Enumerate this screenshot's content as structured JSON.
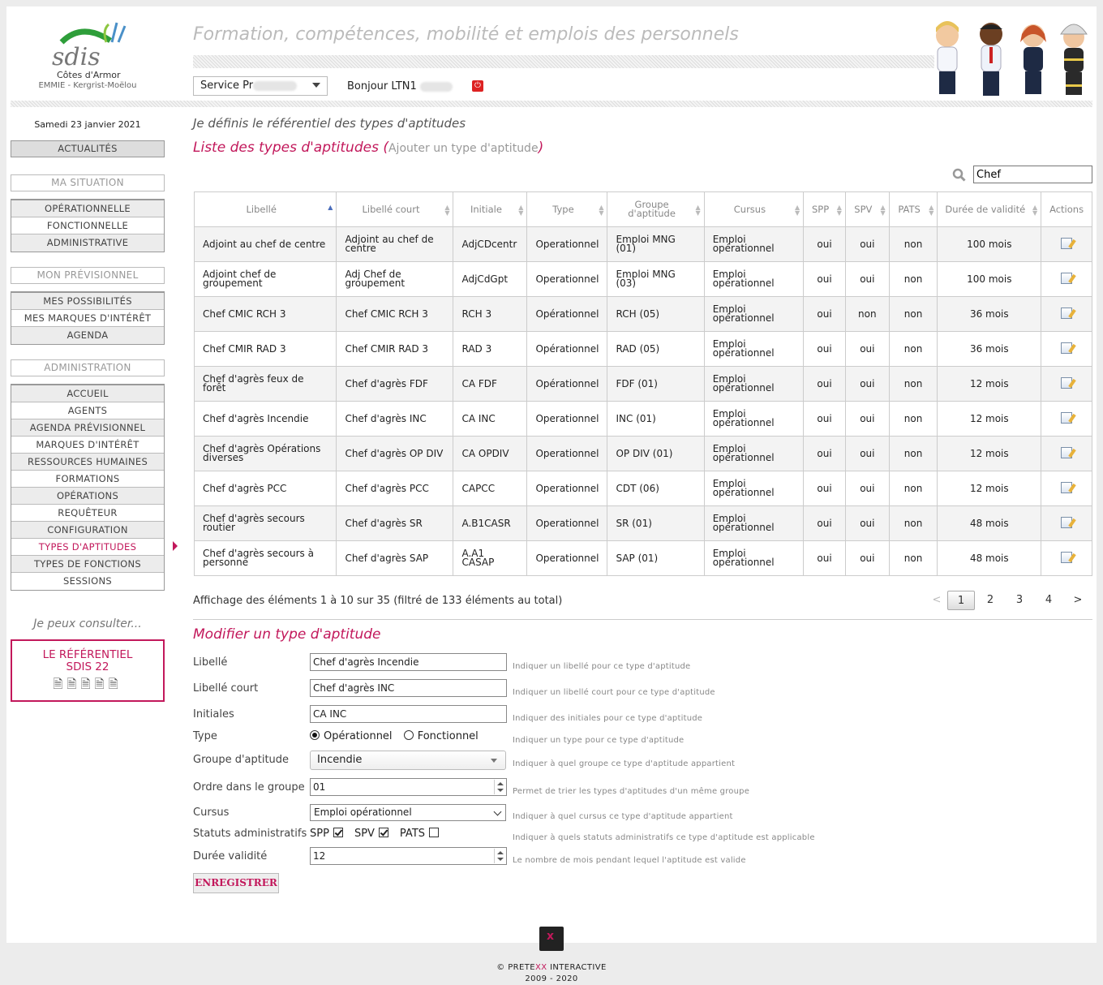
{
  "header": {
    "logo_text": "sdis",
    "logo_subtitle": "Côtes d'Armor",
    "center_name": "EMMIE - Kergrist-Moëlou",
    "site_title": "Formation, compétences, mobilité et emplois des personnels",
    "service_label": "Service Pr",
    "greeting": "Bonjour LTN1"
  },
  "sidebar": {
    "date": "Samedi 23 janvier 2021",
    "actualites": "ACTUALITÉS",
    "situation_head": "MA SITUATION",
    "situation_items": [
      "OPÉRATIONNELLE",
      "FONCTIONNELLE",
      "ADMINISTRATIVE"
    ],
    "previsionnel_head": "MON PRÉVISIONNEL",
    "previsionnel_items": [
      "MES POSSIBILITÉS",
      "MES MARQUES D'INTÉRÊT",
      "AGENDA"
    ],
    "admin_head": "ADMINISTRATION",
    "admin_items": [
      "ACCUEIL",
      "AGENTS",
      "AGENDA PRÉVISIONNEL",
      "MARQUES D'INTÉRÊT",
      "RESSOURCES HUMAINES",
      "FORMATIONS",
      "OPÉRATIONS",
      "REQUÊTEUR",
      "CONFIGURATION",
      "TYPES D'APTITUDES",
      "TYPES DE FONCTIONS",
      "SESSIONS"
    ],
    "admin_active": "TYPES D'APTITUDES",
    "consult_title": "Je peux consulter...",
    "ref_line1": "LE RÉFÉRENTIEL",
    "ref_line2": "SDIS 22"
  },
  "main": {
    "page_heading": "Je définis le référentiel des types d'aptitudes",
    "list_title": "Liste des types d'aptitudes",
    "add_link": "Ajouter un type d'aptitude",
    "search_value": "Chef"
  },
  "table": {
    "columns": [
      "Libellé",
      "Libellé court",
      "Initiale",
      "Type",
      "Groupe d'aptitude",
      "Cursus",
      "SPP",
      "SPV",
      "PATS",
      "Durée de validité",
      "Actions"
    ],
    "rows": [
      [
        "Adjoint au chef de centre",
        "Adjoint au chef de centre",
        "AdjCDcentr",
        "Operationnel",
        "Emploi MNG (01)",
        "Emploi opérationnel",
        "oui",
        "oui",
        "non",
        "100 mois"
      ],
      [
        "Adjoint chef de groupement",
        "Adj Chef de groupement",
        "AdjCdGpt",
        "Operationnel",
        "Emploi MNG (03)",
        "Emploi opérationnel",
        "oui",
        "oui",
        "non",
        "100 mois"
      ],
      [
        "Chef CMIC RCH 3",
        "Chef CMIC RCH 3",
        "RCH 3",
        "Opérationnel",
        "RCH (05)",
        "Emploi opérationnel",
        "oui",
        "non",
        "non",
        "36 mois"
      ],
      [
        "Chef CMIR RAD 3",
        "Chef CMIR RAD 3",
        "RAD 3",
        "Opérationnel",
        "RAD (05)",
        "Emploi opérationnel",
        "oui",
        "oui",
        "non",
        "36 mois"
      ],
      [
        "Chef d'agrès feux de forêt",
        "Chef d'agrès FDF",
        "CA FDF",
        "Opérationnel",
        "FDF (01)",
        "Emploi opérationnel",
        "oui",
        "oui",
        "non",
        "12 mois"
      ],
      [
        "Chef d'agrès Incendie",
        "Chef d'agrès INC",
        "CA INC",
        "Operationnel",
        "INC (01)",
        "Emploi opérationnel",
        "oui",
        "oui",
        "non",
        "12 mois"
      ],
      [
        "Chef d'agrès Opérations diverses",
        "Chef d'agrès OP DIV",
        "CA OPDIV",
        "Operationnel",
        "OP DIV (01)",
        "Emploi opérationnel",
        "oui",
        "oui",
        "non",
        "12 mois"
      ],
      [
        "Chef d'agrès PCC",
        "Chef d'agrès PCC",
        "CAPCC",
        "Operationnel",
        "CDT (06)",
        "Emploi opérationnel",
        "oui",
        "oui",
        "non",
        "12 mois"
      ],
      [
        "Chef d'agrès secours routier",
        "Chef d'agrès SR",
        "A.B1CASR",
        "Operationnel",
        "SR (01)",
        "Emploi opérationnel",
        "oui",
        "oui",
        "non",
        "48 mois"
      ],
      [
        "Chef d'agrès secours à personne",
        "Chef d'agrès SAP",
        "A.A1 CASAP",
        "Operationnel",
        "SAP (01)",
        "Emploi opérationnel",
        "oui",
        "oui",
        "non",
        "48 mois"
      ]
    ]
  },
  "pagination": {
    "info": "Affichage des éléments 1 à 10 sur 35 (filtré de 133 éléments au total)",
    "prev": "<",
    "pages": [
      "1",
      "2",
      "3",
      "4"
    ],
    "current": "1",
    "next": ">"
  },
  "form": {
    "title": "Modifier un type d'aptitude",
    "libelle_label": "Libellé",
    "libelle_value": "Chef d'agrès Incendie",
    "libelle_hint": "Indiquer un libellé pour ce type d'aptitude",
    "court_label": "Libellé court",
    "court_value": "Chef d'agrès INC",
    "court_hint": "Indiquer un libellé court pour ce type d'aptitude",
    "initiales_label": "Initiales",
    "initiales_value": "CA INC",
    "initiales_hint": "Indiquer des initiales pour ce type d'aptitude",
    "type_label": "Type",
    "type_opt1": "Opérationnel",
    "type_opt2": "Fonctionnel",
    "type_hint": "Indiquer un type pour ce type d'aptitude",
    "groupe_label": "Groupe d'aptitude",
    "groupe_value": "Incendie",
    "groupe_hint": "Indiquer à quel groupe ce type d'aptitude appartient",
    "ordre_label": "Ordre dans le groupe",
    "ordre_value": "01",
    "ordre_hint": "Permet de trier les types d'aptitudes d'un même groupe",
    "cursus_label": "Cursus",
    "cursus_value": "Emploi opérationnel",
    "cursus_hint": "Indiquer à quel cursus ce type d'aptitude appartient",
    "statuts_label": "Statuts administratifs",
    "spp": "SPP",
    "spv": "SPV",
    "pats": "PATS",
    "statuts_hint": "Indiquer à quels statuts administratifs ce type d'aptitude est applicable",
    "duree_label": "Durée validité",
    "duree_value": "12",
    "duree_hint": "Le nombre de mois pendant lequel l'aptitude est valide",
    "save_label": "ENREGISTRER"
  },
  "footer": {
    "copy": "© PRETE",
    "xx": "XX",
    "rest": " INTERACTIVE",
    "years": "2009 - 2020"
  },
  "colors": {
    "accent": "#c2185b",
    "logo_green": "#2e9e3a",
    "logo_blue": "#2d6fb7"
  }
}
